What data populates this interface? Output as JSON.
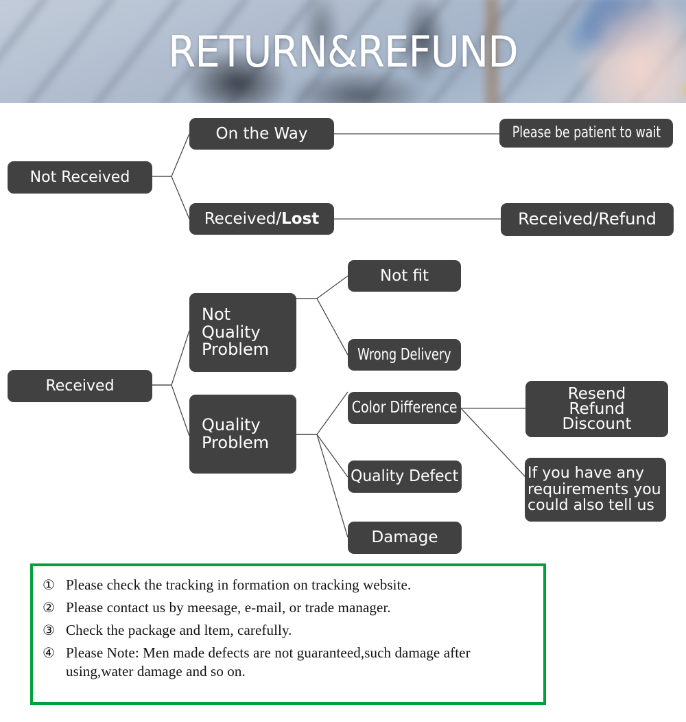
{
  "banner": {
    "title": "RETURN&REFUND",
    "background_icon": "blurred-deck-photo"
  },
  "colors": {
    "node_fill": "#414141",
    "node_text": "#ffffff",
    "connector": "#4a4a4a",
    "notes_border": "#00a13d",
    "page_background": "#ffffff"
  },
  "flowchart": {
    "title": "Return and Refund Decision Tree",
    "nodes": {
      "not_received": "Not Received",
      "on_the_way": "On the Way",
      "received_lost_prefix": "Received/",
      "received_lost_bold": "Lost",
      "please_be_patient": "Please be patient to wait",
      "received_refund": "Received/Refund",
      "received": "Received",
      "not_quality_problem": "Not\nQuality\nProblem",
      "not_fit": "Not fit",
      "wrong_delivery": "Wrong Delivery",
      "quality_problem": "Quality\nProblem",
      "color_difference": "Color Difference",
      "quality_defect": "Quality Defect",
      "damage": "Damage",
      "resend_refund_discount": "Resend\nRefund\nDiscount",
      "if_you_have_any": "If you have any\nrequirements you\ncould also tell us"
    },
    "edges": [
      {
        "from": "not_received",
        "to": "on_the_way"
      },
      {
        "from": "not_received",
        "to": "received_lost"
      },
      {
        "from": "on_the_way",
        "to": "please_be_patient"
      },
      {
        "from": "received_lost",
        "to": "received_refund"
      },
      {
        "from": "received",
        "to": "not_quality_problem"
      },
      {
        "from": "received",
        "to": "quality_problem"
      },
      {
        "from": "not_quality_problem",
        "to": "not_fit"
      },
      {
        "from": "not_quality_problem",
        "to": "wrong_delivery"
      },
      {
        "from": "quality_problem",
        "to": "color_difference"
      },
      {
        "from": "quality_problem",
        "to": "quality_defect"
      },
      {
        "from": "quality_problem",
        "to": "damage"
      },
      {
        "from": "color_difference",
        "to": "resend_refund_discount"
      },
      {
        "from": "color_difference",
        "to": "if_you_have_any"
      }
    ]
  },
  "notes": {
    "items": [
      {
        "marker": "①",
        "text": "Please check the tracking in formation on tracking website."
      },
      {
        "marker": "②",
        "text": "Please contact us by meesage, e-mail, or trade manager."
      },
      {
        "marker": "③",
        "text": "Check the package and ltem, carefully."
      },
      {
        "marker": "④",
        "text": "Please Note: Men made defects  are not guaranteed,such damage after using,water damage and so on."
      }
    ]
  }
}
